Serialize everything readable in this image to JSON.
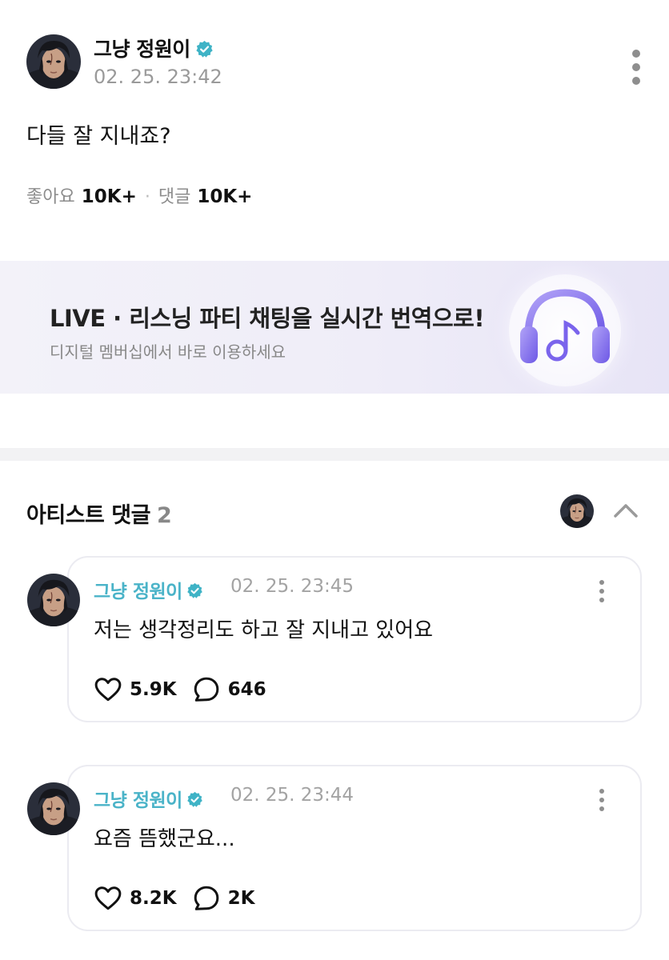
{
  "post": {
    "author": "그냥 정원이",
    "time": "02. 25. 23:42",
    "body": "다들 잘 지내죠?",
    "likes_label": "좋아요",
    "likes_count": "10K+",
    "comments_label": "댓글",
    "comments_count": "10K+",
    "separator": "·"
  },
  "banner": {
    "title": "LIVE · 리스닝 파티 채팅을 실시간 번역으로!",
    "subtitle": "디지털 멤버십에서 바로 이용하세요",
    "icon": "headphones-music-icon"
  },
  "artist_comments": {
    "title": "아티스트 댓글",
    "count": "2",
    "items": [
      {
        "author": "그냥 정원이",
        "time": "02. 25. 23:45",
        "text": "저는 생각정리도 하고 잘 지내고 있어요",
        "likes": "5.9K",
        "replies": "646"
      },
      {
        "author": "그냥 정원이",
        "time": "02. 25. 23:44",
        "text": "요즘 뜸했군요...",
        "likes": "8.2K",
        "replies": "2K"
      }
    ]
  },
  "colors": {
    "accent_name": "#4ab3c8",
    "verified_badge": "#3fb3c6",
    "muted_text": "#9a9a9a",
    "banner_icon_purple": "#8a6df0"
  }
}
